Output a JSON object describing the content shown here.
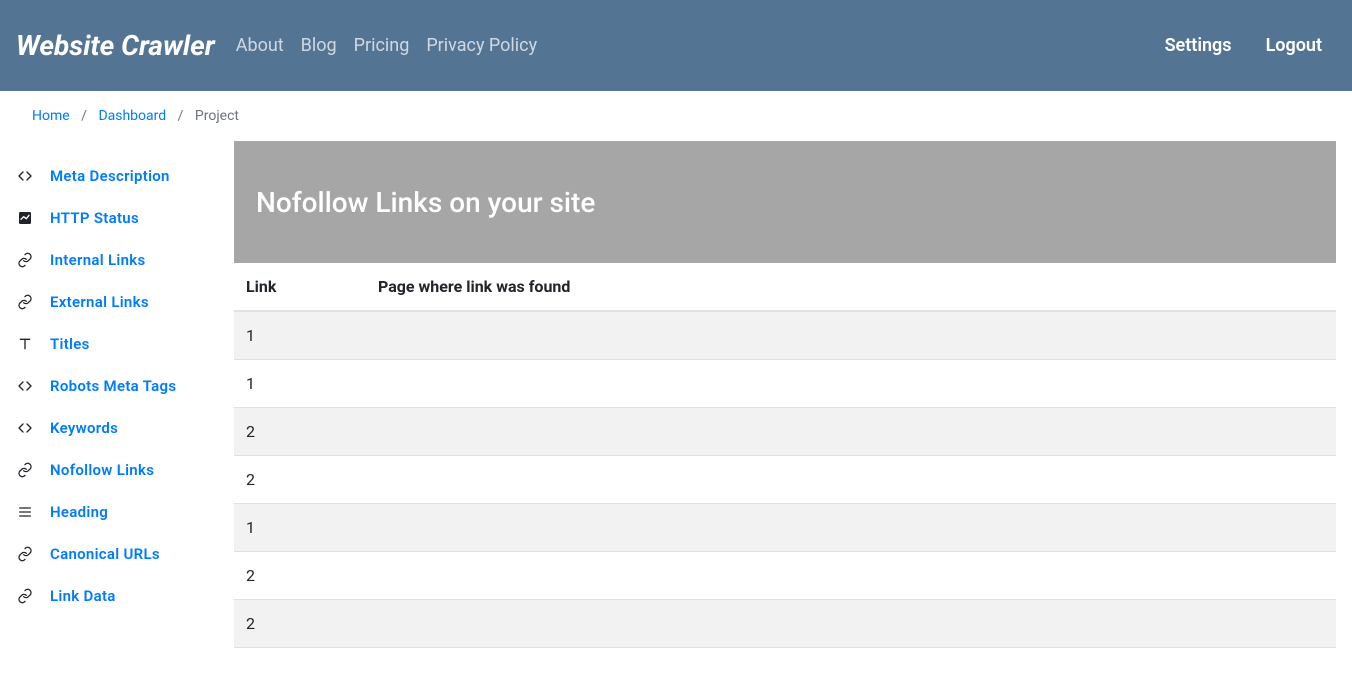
{
  "header": {
    "brand": "Website Crawler",
    "nav": [
      "About",
      "Blog",
      "Pricing",
      "Privacy Policy"
    ],
    "right": [
      "Settings",
      "Logout"
    ]
  },
  "breadcrumb": {
    "items": [
      {
        "label": "Home",
        "link": true
      },
      {
        "label": "Dashboard",
        "link": true
      },
      {
        "label": "Project",
        "link": false
      }
    ]
  },
  "sidebar": {
    "items": [
      {
        "icon": "code",
        "label": "Meta Description"
      },
      {
        "icon": "chart",
        "label": "HTTP Status"
      },
      {
        "icon": "link",
        "label": "Internal Links"
      },
      {
        "icon": "link",
        "label": "External Links"
      },
      {
        "icon": "text",
        "label": "Titles"
      },
      {
        "icon": "code",
        "label": "Robots Meta Tags"
      },
      {
        "icon": "code",
        "label": "Keywords"
      },
      {
        "icon": "link",
        "label": "Nofollow Links"
      },
      {
        "icon": "list",
        "label": "Heading"
      },
      {
        "icon": "link",
        "label": "Canonical URLs"
      },
      {
        "icon": "link",
        "label": "Link Data"
      }
    ]
  },
  "main": {
    "title": "Nofollow Links on your site",
    "columns": [
      "Link",
      "Page where link was found"
    ],
    "rows": [
      {
        "link": "1",
        "page": ""
      },
      {
        "link": "1",
        "page": ""
      },
      {
        "link": "2",
        "page": ""
      },
      {
        "link": "2",
        "page": ""
      },
      {
        "link": "1",
        "page": ""
      },
      {
        "link": "2",
        "page": ""
      },
      {
        "link": "2",
        "page": ""
      }
    ]
  }
}
